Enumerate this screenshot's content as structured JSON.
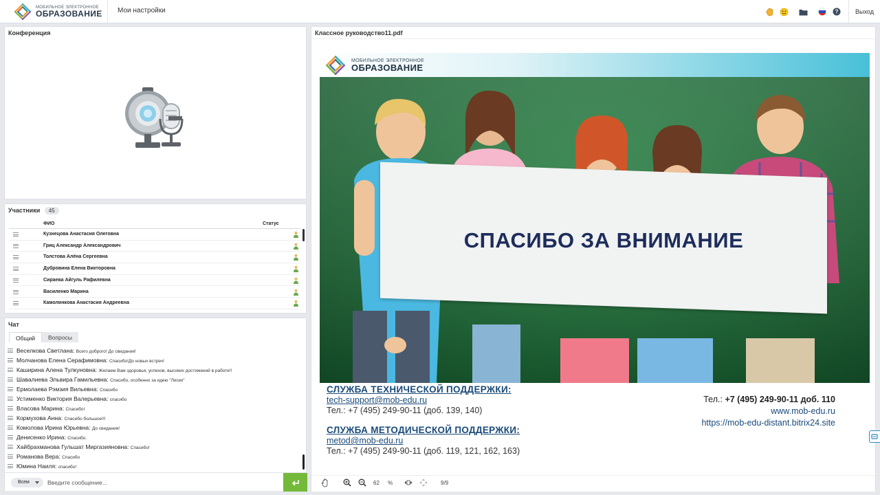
{
  "header": {
    "logo_small": "МОБИЛЬНОЕ ЭЛЕКТРОННОЕ",
    "logo_big": "ОБРАЗОВАНИЕ",
    "settings_link": "Мои настройки",
    "exit_label": "Выход",
    "icons": [
      "hand-icon",
      "emoji-icon",
      "folder-icon",
      "russian-flag-icon",
      "help-icon"
    ]
  },
  "conference": {
    "title": "Конференция",
    "icon": "webcam-microphone-icon"
  },
  "participants": {
    "title": "Участники",
    "count": "45",
    "columns": {
      "name": "ФИО",
      "status": "Статус"
    },
    "rows": [
      {
        "name": "Кузнецова Анастасия  Олеговна"
      },
      {
        "name": "Гриц Александр  Александрович"
      },
      {
        "name": "Толстова Алёна  Сергеевна"
      },
      {
        "name": "Дубровина Елена  Викторовна"
      },
      {
        "name": "Сираева Айгуль Рафилевна"
      },
      {
        "name": "Василенко Марина"
      },
      {
        "name": "Камолинкова Анастасия  Андреевна"
      }
    ]
  },
  "chat": {
    "title": "Чат",
    "tabs": [
      {
        "label": "Общий"
      },
      {
        "label": "Вопросы"
      }
    ],
    "messages": [
      {
        "author": "Веселкова Светлана:",
        "text": "Всего доброго! До свидания!"
      },
      {
        "author": "Молчанова Елена  Серафимовна:",
        "text": "Спасибо!До новых встреч!"
      },
      {
        "author": "Каширина Алена   Тулкуновна:",
        "text": "Желаем Вам здоровья, успехов, высоких достижений в работе!!"
      },
      {
        "author": "Шавалиева Эльвира  Гамильевна:",
        "text": "Спасибо, особенно за  идею \"Лисик\""
      },
      {
        "author": "Ермолаева Рэмзия  Вильевна:",
        "text": "Спасибо"
      },
      {
        "author": "Устименко Виктория Валерьевна:",
        "text": "спасибо"
      },
      {
        "author": "Власова Марина:",
        "text": "Спасибо!"
      },
      {
        "author": "Кормухова Анна:",
        "text": "Спасибо большое!!!"
      },
      {
        "author": "Комолова Ирина  Юрьевна:",
        "text": "До свидания!"
      },
      {
        "author": "Денисенко Ирина:",
        "text": "Спасибо."
      },
      {
        "author": "Хайбрахманова Гульшат  Миргазияновна:",
        "text": "Спасибо!"
      },
      {
        "author": "Романова Вера:",
        "text": "Спасибо"
      },
      {
        "author": "Юмина Наиля:",
        "text": "спасибо!"
      }
    ],
    "recipient_select": "Всем",
    "input_placeholder": "Введите сообщение..."
  },
  "document": {
    "filename": "Классное руководство11.pdf",
    "slide": {
      "logo_small": "МОБИЛЬНОЕ ЭЛЕКТРОННОЕ",
      "logo_big": "ОБРАЗОВАНИЕ",
      "banner_text": "СПАСИБО ЗА ВНИМАНИЕ",
      "tech_support_heading": "СЛУЖБА ТЕХНИЧЕСКОЙ ПОДДЕРЖКИ:",
      "tech_support_email": "tech-support@mob-edu.ru",
      "tech_support_phone": "Тел.: +7 (495)  249-90-11 (доб. 139, 140)",
      "method_support_heading": "СЛУЖБА МЕТОДИЧЕСКОЙ ПОДДЕРЖКИ:",
      "method_support_email": "metod@mob-edu.ru",
      "method_support_phone": "Тел.: +7 (495)  249-90-11 (доб. 119, 121,  162,  163)",
      "contact_phone_prefix": "Тел.: ",
      "contact_phone": "+7 (495) 249-90-11 доб. 110",
      "contact_site": "www.mob-edu.ru",
      "contact_portal": "https://mob-edu-distant.bitrix24.site"
    },
    "toolbar": {
      "zoom": "62",
      "zoom_unit": "%",
      "page": "9/9"
    }
  },
  "colors": {
    "accent_green": "#74b93a",
    "brand_navy": "#1d2d5c",
    "link_blue": "#1a4a7a"
  }
}
